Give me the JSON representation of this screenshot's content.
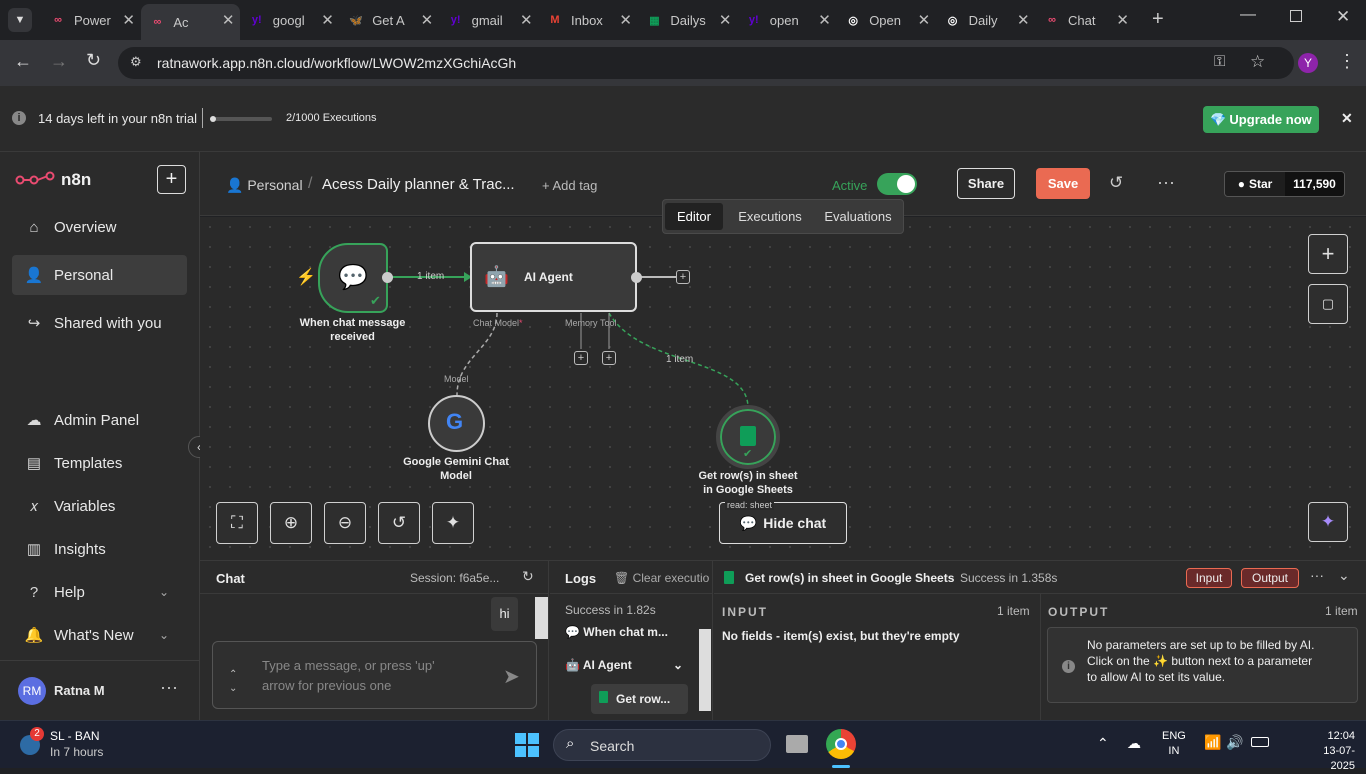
{
  "browser": {
    "tabs": [
      {
        "title": "Power",
        "icon": "n8n",
        "color": "#ea4b71"
      },
      {
        "title": "Ac",
        "icon": "n8n",
        "color": "#ea4b71",
        "active": true
      },
      {
        "title": "googl",
        "icon": "yahoo",
        "color": "#6001d2"
      },
      {
        "title": "Get A",
        "icon": "bluesky",
        "color": "#1185fe"
      },
      {
        "title": "gmail",
        "icon": "yahoo",
        "color": "#6001d2"
      },
      {
        "title": "Inbox",
        "icon": "gmail",
        "color": "#ea4335"
      },
      {
        "title": "Dailys",
        "icon": "sheets",
        "color": "#0f9d58"
      },
      {
        "title": "open",
        "icon": "yahoo",
        "color": "#6001d2"
      },
      {
        "title": "Open",
        "icon": "openai",
        "color": "#ffffff"
      },
      {
        "title": "Daily",
        "icon": "openai",
        "color": "#ffffff"
      },
      {
        "title": "Chat",
        "icon": "n8n",
        "color": "#ea4b71"
      }
    ],
    "url": "ratnawork.app.n8n.cloud/workflow/LWOW2mzXGchiAcGh",
    "profile_initial": "Y"
  },
  "trial": {
    "text": "14 days left in your n8n trial",
    "executions": "2/1000 Executions",
    "progress": 0.002,
    "upgrade_label": "Upgrade now"
  },
  "sidebar": {
    "brand": "n8n",
    "items": [
      {
        "label": "Overview",
        "icon": "home-icon"
      },
      {
        "label": "Personal",
        "icon": "user-icon",
        "active": true
      },
      {
        "label": "Shared with you",
        "icon": "share-icon"
      }
    ],
    "lower_items": [
      {
        "label": "Admin Panel",
        "icon": "cloud-icon"
      },
      {
        "label": "Templates",
        "icon": "templates-icon"
      },
      {
        "label": "Variables",
        "icon": "variables-icon"
      },
      {
        "label": "Insights",
        "icon": "insights-icon"
      },
      {
        "label": "Help",
        "icon": "help-icon"
      },
      {
        "label": "What's New",
        "icon": "bell-icon"
      }
    ],
    "user": {
      "initials": "RM",
      "name": "Ratna M"
    }
  },
  "header": {
    "breadcrumb_project": "Personal",
    "workflow_name": "Acess Daily planner  & Trac...",
    "add_tag": "+ Add tag",
    "active_label": "Active",
    "share_label": "Share",
    "save_label": "Save",
    "star_label": "Star",
    "star_count": "117,590",
    "tabs": [
      "Editor",
      "Executions",
      "Evaluations"
    ]
  },
  "workflow": {
    "trigger_label_1": "When chat message",
    "trigger_label_2": "received",
    "conn_label": "1 item",
    "agent_label": "AI Agent",
    "chat_model_label": "Chat Model",
    "memory_label": "Memory",
    "tool_label": "Tool",
    "tool_conn_label": "1 item",
    "model_label": "Model",
    "gemini_label_1": "Google Gemini Chat",
    "gemini_label_2": "Model",
    "sheets_label_1": "Get row(s) in sheet",
    "sheets_label_2": "in Google Sheets",
    "sheets_sub": "read: sheet",
    "hide_chat_label": "Hide chat"
  },
  "chat_panel": {
    "title": "Chat",
    "session": "Session: f6a5e...",
    "message": "hi",
    "input_placeholder": "Type a message, or press 'up' arrow for previous one"
  },
  "logs_panel": {
    "title": "Logs",
    "clear_label": "Clear executio",
    "status": "Success in 1.82s",
    "entries": [
      "When chat m...",
      "AI Agent",
      "Get row..."
    ]
  },
  "node_panel": {
    "title": "Get row(s) in sheet in Google Sheets",
    "status": "Success in 1.358s",
    "input_btn": "Input",
    "output_btn": "Output",
    "input_heading": "INPUT",
    "input_count": "1 item",
    "input_text": "No fields - item(s) exist, but they're empty",
    "output_heading": "OUTPUT",
    "output_count": "1 item",
    "output_note_1": "No parameters are set up to be filled by AI.",
    "output_note_2a": "Click on the",
    "output_note_2b": "button next to a parameter",
    "output_note_3": "to allow AI to set its value."
  },
  "taskbar": {
    "weather_badge": "2",
    "weather_title": "SL - BAN",
    "weather_sub": "In 7 hours",
    "search_label": "Search",
    "lang_1": "ENG",
    "lang_2": "IN",
    "time": "12:04",
    "date": "13-07-2025"
  }
}
